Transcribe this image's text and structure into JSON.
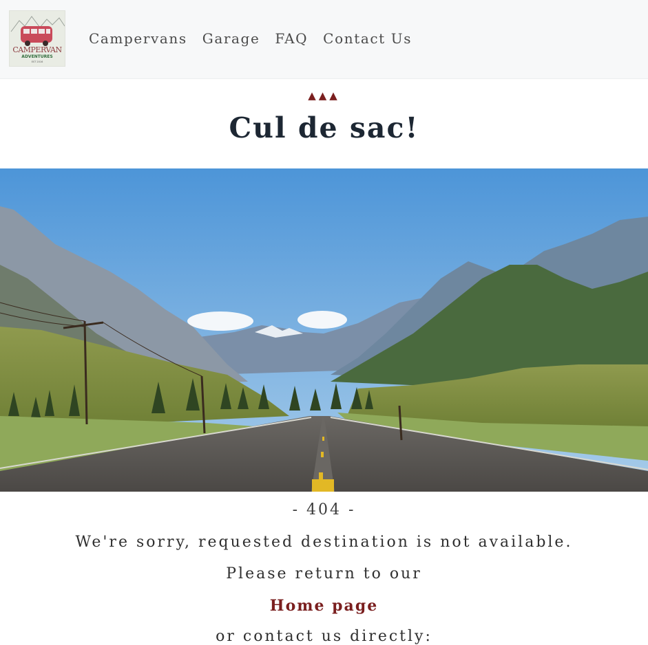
{
  "brand": {
    "logo_name": "CAMPERVAN",
    "logo_tagline": "ADVENTURES",
    "logo_small": "EST 2016"
  },
  "nav": {
    "items": [
      {
        "label": "Campervans"
      },
      {
        "label": "Garage"
      },
      {
        "label": "FAQ"
      },
      {
        "label": "Contact Us"
      }
    ]
  },
  "hero": {
    "decoration": "▲▲▲",
    "title": "Cul de sac!"
  },
  "error": {
    "code": "- 404 -",
    "message": "We're sorry, requested destination is not available.",
    "return_text": "Please return to our",
    "home_link": "Home page",
    "contact_text": "or contact us directly:"
  },
  "colors": {
    "accent": "#7a1f1f",
    "title": "#1d2733",
    "navbar_bg": "#f7f8f9"
  },
  "icons": {
    "logo": "campervan-logo-icon",
    "decoration": "triangle-icon"
  }
}
